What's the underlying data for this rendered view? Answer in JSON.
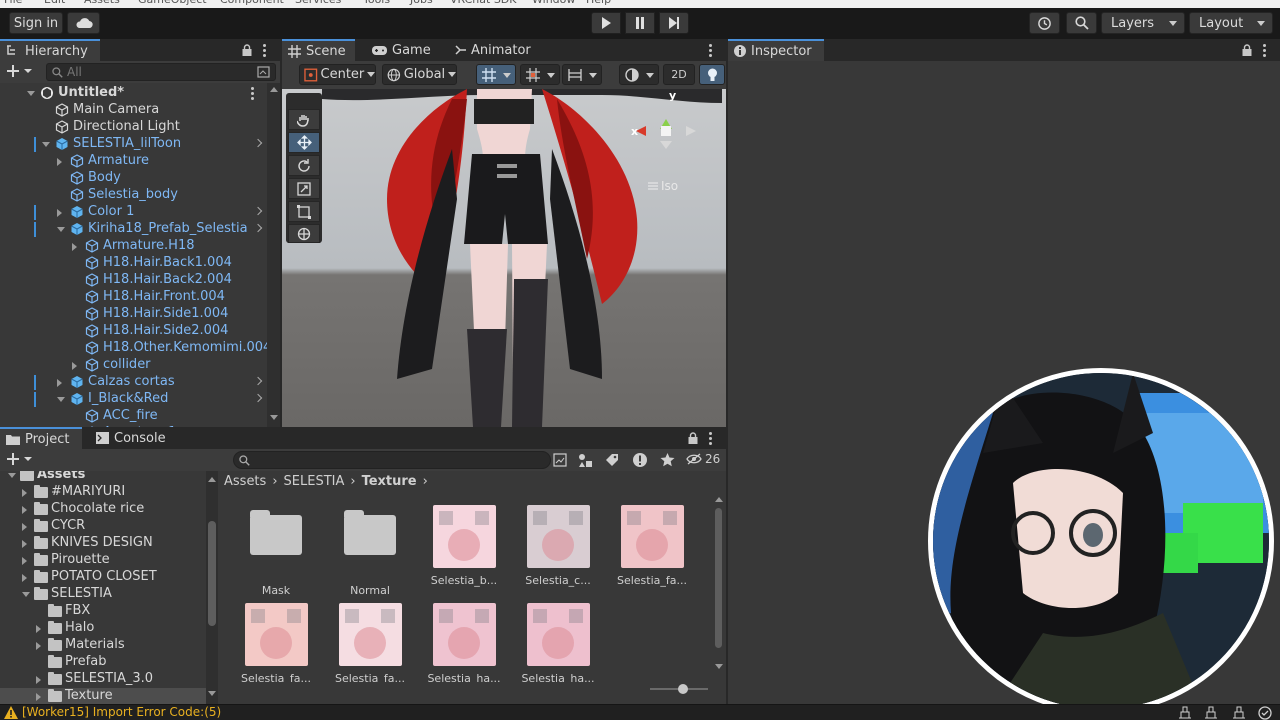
{
  "menubar": [
    "File",
    "Edit",
    "Assets",
    "GameObject",
    "Component",
    "Services",
    "Tools",
    "Jobs",
    "VRChat SDK",
    "Window",
    "Help"
  ],
  "toolbar": {
    "sign_in": "Sign in",
    "layers": "Layers",
    "layout": "Layout"
  },
  "hierarchy": {
    "tab": "Hierarchy",
    "search_placeholder": "All",
    "rows": [
      {
        "label": "Untitled*",
        "depth": 0,
        "icon": "unity-scene-icon",
        "expand": "open",
        "bold": true
      },
      {
        "label": "Main Camera",
        "depth": 1,
        "icon": "gameobject-icon",
        "expand": "none"
      },
      {
        "label": "Directional Light",
        "depth": 1,
        "icon": "gameobject-icon",
        "expand": "none"
      },
      {
        "label": "SELESTIA_lilToon",
        "depth": 1,
        "icon": "prefab-icon",
        "expand": "open",
        "prefab": true,
        "bar": true,
        "chev": true
      },
      {
        "label": "Armature",
        "depth": 2,
        "icon": "gameobject-icon",
        "expand": "closed",
        "prefab": true
      },
      {
        "label": "Body",
        "depth": 2,
        "icon": "gameobject-icon",
        "expand": "none",
        "prefab": true
      },
      {
        "label": "Selestia_body",
        "depth": 2,
        "icon": "gameobject-icon",
        "expand": "none",
        "prefab": true
      },
      {
        "label": "Color 1",
        "depth": 2,
        "icon": "prefab-icon",
        "expand": "closed",
        "prefab": true,
        "bar": true,
        "chev": true
      },
      {
        "label": "Kiriha18_Prefab_Selestia",
        "depth": 2,
        "icon": "prefab-icon",
        "expand": "open",
        "prefab": true,
        "bar": true,
        "chev": true
      },
      {
        "label": "Armature.H18",
        "depth": 3,
        "icon": "gameobject-icon",
        "expand": "closed",
        "prefab": true
      },
      {
        "label": "H18.Hair.Back1.004",
        "depth": 3,
        "icon": "gameobject-icon",
        "expand": "none",
        "prefab": true
      },
      {
        "label": "H18.Hair.Back2.004",
        "depth": 3,
        "icon": "gameobject-icon",
        "expand": "none",
        "prefab": true
      },
      {
        "label": "H18.Hair.Front.004",
        "depth": 3,
        "icon": "gameobject-icon",
        "expand": "none",
        "prefab": true
      },
      {
        "label": "H18.Hair.Side1.004",
        "depth": 3,
        "icon": "gameobject-icon",
        "expand": "none",
        "prefab": true
      },
      {
        "label": "H18.Hair.Side2.004",
        "depth": 3,
        "icon": "gameobject-icon",
        "expand": "none",
        "prefab": true
      },
      {
        "label": "H18.Other.Kemomimi.004",
        "depth": 3,
        "icon": "gameobject-icon",
        "expand": "none",
        "prefab": true
      },
      {
        "label": "collider",
        "depth": 3,
        "icon": "gameobject-icon",
        "expand": "closed",
        "prefab": true
      },
      {
        "label": "Calzas cortas",
        "depth": 2,
        "icon": "prefab-icon",
        "expand": "closed",
        "prefab": true,
        "bar": true,
        "chev": true
      },
      {
        "label": "I_Black&Red",
        "depth": 2,
        "icon": "prefab-icon",
        "expand": "open",
        "prefab": true,
        "bar": true,
        "chev": true
      },
      {
        "label": "ACC_fire",
        "depth": 3,
        "icon": "gameobject-icon",
        "expand": "none",
        "prefab": true
      },
      {
        "label": "Armature 1",
        "depth": 3,
        "icon": "gameobject-icon",
        "expand": "closed",
        "prefab": true
      }
    ]
  },
  "scene": {
    "tabs": [
      "Scene",
      "Game",
      "Animator"
    ],
    "pivot": "Center",
    "space": "Global",
    "mode_2d": "2D",
    "gizmo_x": "x",
    "gizmo_y": "y",
    "iso": "Iso"
  },
  "inspector": {
    "tab": "Inspector"
  },
  "project": {
    "tabs": [
      "Project",
      "Console"
    ],
    "visible_count": "26",
    "breadcrumb": [
      "Assets",
      "SELESTIA",
      "Texture"
    ],
    "tree": [
      {
        "label": "Assets",
        "depth": 0,
        "expand": "open",
        "bold": true
      },
      {
        "label": "#MARIYURI",
        "depth": 1,
        "expand": "closed"
      },
      {
        "label": "Chocolate rice",
        "depth": 1,
        "expand": "closed"
      },
      {
        "label": "CYCR",
        "depth": 1,
        "expand": "closed"
      },
      {
        "label": "KNIVES DESIGN",
        "depth": 1,
        "expand": "closed"
      },
      {
        "label": "Pirouette",
        "depth": 1,
        "expand": "closed"
      },
      {
        "label": "POTATO CLOSET",
        "depth": 1,
        "expand": "closed"
      },
      {
        "label": "SELESTIA",
        "depth": 1,
        "expand": "open"
      },
      {
        "label": "FBX",
        "depth": 2,
        "expand": "none"
      },
      {
        "label": "Halo",
        "depth": 2,
        "expand": "closed"
      },
      {
        "label": "Materials",
        "depth": 2,
        "expand": "closed"
      },
      {
        "label": "Prefab",
        "depth": 2,
        "expand": "none"
      },
      {
        "label": "SELESTIA_3.0",
        "depth": 2,
        "expand": "closed"
      },
      {
        "label": "Texture",
        "depth": 2,
        "expand": "closed",
        "selected": true
      }
    ],
    "assets": [
      {
        "label": "Mask",
        "kind": "folder"
      },
      {
        "label": "Normal",
        "kind": "folder"
      },
      {
        "label": "Selestia_b...",
        "kind": "texture",
        "color": "#f6d6de"
      },
      {
        "label": "Selestia_c...",
        "kind": "texture",
        "color": "#d9cdd2"
      },
      {
        "label": "Selestia_fa...",
        "kind": "texture",
        "color": "#f0c4c8"
      },
      {
        "label": "Selestia_fa...",
        "kind": "texture",
        "color": "#f3c9c6"
      },
      {
        "label": "Selestia_fa...",
        "kind": "texture",
        "color": "#f5dde2"
      },
      {
        "label": "Selestia_ha...",
        "kind": "texture",
        "color": "#efc3d0"
      },
      {
        "label": "Selestia_ha...",
        "kind": "texture",
        "color": "#eec0ce"
      }
    ]
  },
  "status": {
    "message": "[Worker15] Import Error Code:(5)"
  },
  "colors": {
    "accent": "#4a90d9",
    "prefab_text": "#7fb8f5",
    "warning": "#e8b020"
  }
}
